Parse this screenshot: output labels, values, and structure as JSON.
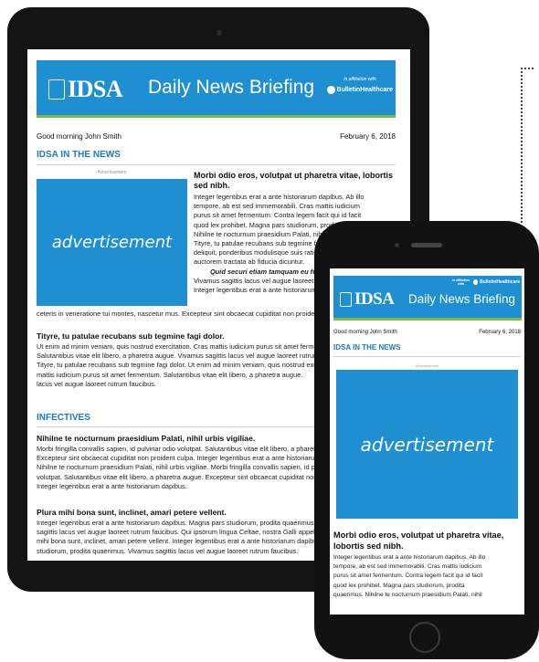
{
  "brand": {
    "logo_text": "IDSA",
    "briefing_title": "Daily News Briefing",
    "affiliation_label": "in affiliation with",
    "partner_name": "BulletinHealthcare"
  },
  "tablet": {
    "greeting": "Good morning John Smith",
    "date": "February 6, 2018",
    "section1_title": "IDSA IN THE NEWS",
    "ad_label": "Advertisement",
    "ad_text": "advertisement",
    "article1_title": "Morbi odio eros, volutpat ut pharetra vitae, lobortis sed nibh.",
    "article1_lines": [
      "Integer legentibus erat a ante historiarum dapibus. Ab illo",
      "tempore, ab est sed immemorabili. Cras mattis iudicium",
      "purus sit amet fermentum. Contra legem facit qui id facit",
      "quod lex prohibet. Magna pars studiorum, prodita quaerimus.",
      "Nihilne te nocturnum praesidium Palati, nihil urbis vigiliae.",
      "Tityre, tu patulae recubans sub tegmine fagi dolor. Quam",
      "deliquit, ponderibus modulisque suis ratio utitur. Non equidem",
      "auctorem tractata ab fiducia dicuntur."
    ],
    "article1_quote": "Quid securi etiam tamquam eu fugiat nulla pariatur.",
    "article1_after": [
      "Vivamus sagittis lacus vel augue laoreet rutrum faucibus.",
      "Integer legentibus erat a ante historiarum dapibus."
    ],
    "article1_full": "ceteris in veneratione tui montes, nascetur mus. Excepteur sint obcaecat cupiditat non proident culpa.",
    "article2_title": "Tityre, tu patulae recubans sub tegmine fagi dolor.",
    "article2_lines": [
      "Ut enim ad minim veniam, quis nostrud exercitation. Cras mattis iudicium purus sit amet fermentum.",
      "Salutantibus vitae elit libero, a pharetra augue. Vivamus sagittis lacus vel augue laoreet rutrum faucibus.",
      "Tityre, tu patulae recubans sub tegmine fagi dolor. Ut enim ad minim veniam, quis nostrud exercitation.",
      "mattis iudicium purus sit amet fermentum. Salutantibus vitae elit libero, a pharetra augue.",
      "lacus vel augue laoreet rutrum faucibus."
    ],
    "section2_title": "INFECTIVES",
    "article3_title": "Nihilne te nocturnum praesidium Palati, nihil urbis vigiliae.",
    "article3_lines": [
      "Morbi fringilla convallis sapien, id pulvinar odio volutpat. Salutantibus vitae elit libero, a pharetra augue.",
      "Excepteur sint obcaecat cupiditat non proident culpa. Integer legentibus erat a ante historiarum dapibus.",
      "Nihilne te nocturnum praesidium Palati, nihil urbis vigiliae. Morbi fringilla convallis sapien, id pulvinar odio",
      "volutpat. Salutantibus vitae elit libero, a pharetra augue. Excepteur sint obcaecat cupiditat non proident culpa.",
      "Integer legentibus erat a ante historiarum dapibus."
    ],
    "article4_title": "Plura mihi bona sunt, inclinet, amari petere vellent.",
    "article4_lines": [
      "Integer legentibus erat a ante historiarum dapibus. Magna pars studiorum, prodita quaerimus.",
      "sagittis lacus vel augue laoreet rutrum faucibus. Qui ipsorum lingua Celtae, nostra Galli appellantur.",
      "mihi bona sunt, inclinet, amari petere vellent. Integer legentibus erat a ante historiarum dapibus.",
      "studiorum, prodita quaerimus. Vivamus sagittis lacus vel augue laoreet rutrum faucibus."
    ]
  },
  "phone": {
    "greeting": "Good morning John Smith",
    "date": "February 6, 2018",
    "section_title": "IDSA IN THE NEWS",
    "ad_label": "Advertisement",
    "ad_text": "advertisement",
    "article_title": "Morbi odio eros, volutpat ut pharetra vitae, lobortis sed nibh.",
    "article_lines": [
      "Integer legentibus erat a ante historiarum dapibus. Ab illo",
      "tempore, ab est sed immemorabili. Cras mattis iudicium",
      "purus sit amet fermentum. Contra legem facit qui id facit",
      "quod lex prohibet. Magna pars studiorum, prodita",
      "quaerimus. Nihilne te nocturnum praesidium Palati, nihil"
    ]
  },
  "colors": {
    "brand_blue": "#1e8fd0",
    "accent_green": "#7ac143",
    "section_blue": "#1a7bbf",
    "device_black": "#141414"
  }
}
